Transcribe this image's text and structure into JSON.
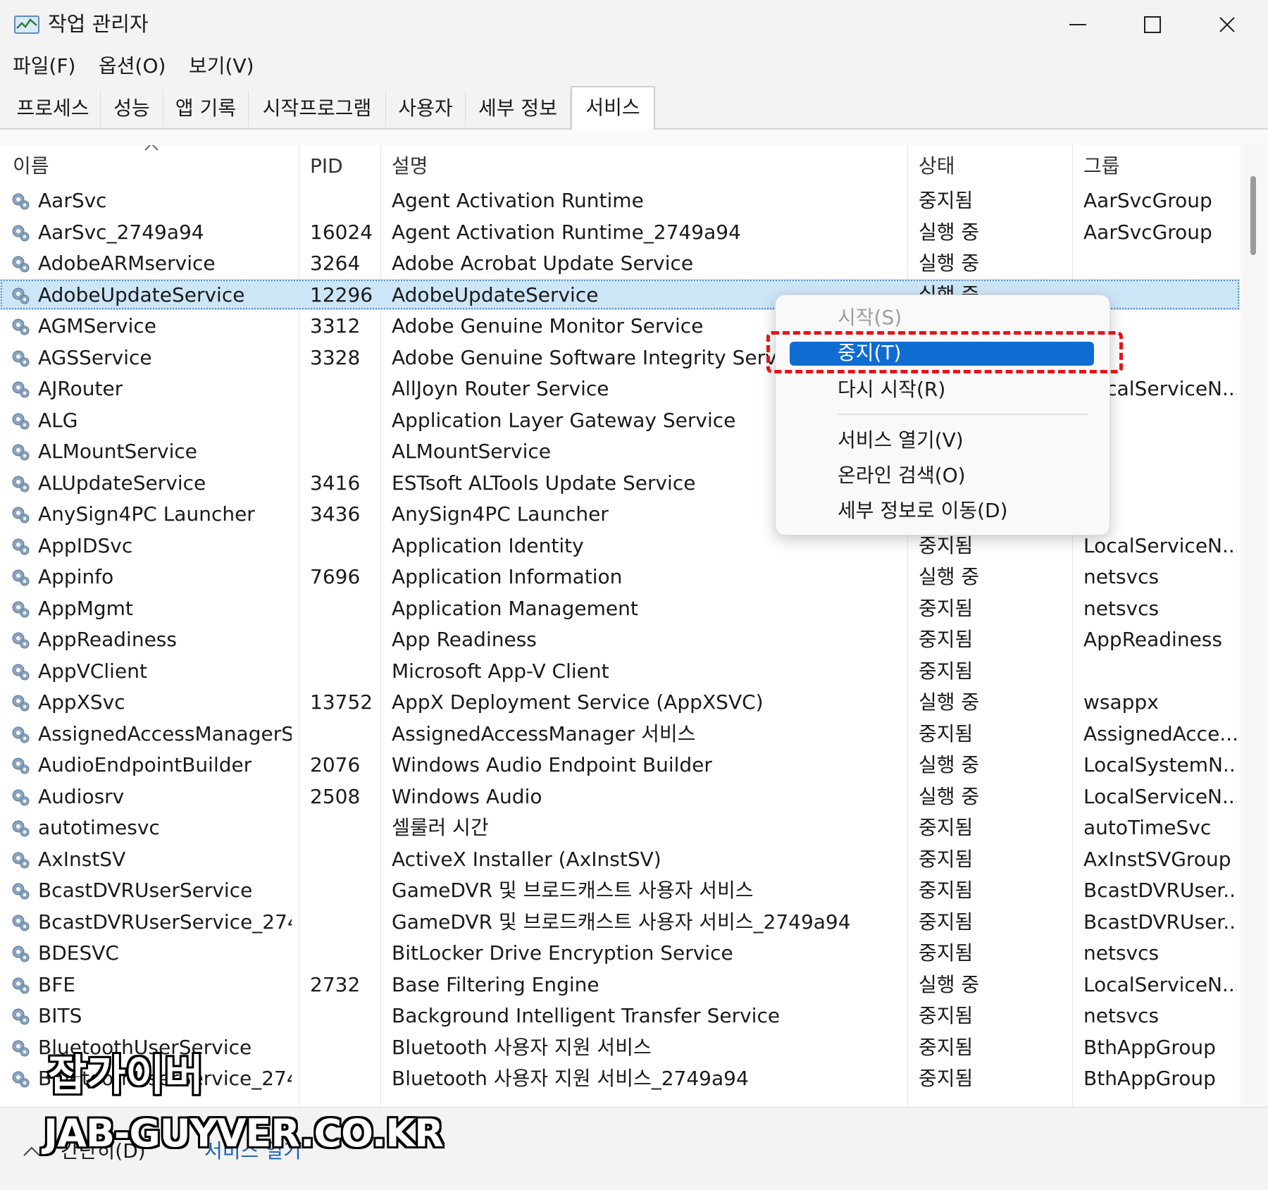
{
  "window": {
    "title": "작업 관리자"
  },
  "menu": {
    "file": "파일(F)",
    "options": "옵션(O)",
    "view": "보기(V)"
  },
  "tabs": [
    "프로세스",
    "성능",
    "앱 기록",
    "시작프로그램",
    "사용자",
    "세부 정보",
    "서비스"
  ],
  "active_tab": "서비스",
  "columns": {
    "name": "이름",
    "pid": "PID",
    "desc": "설명",
    "status": "상태",
    "group": "그룹"
  },
  "rows": [
    {
      "name": "AarSvc",
      "pid": "",
      "desc": "Agent Activation Runtime",
      "status": "중지됨",
      "group": "AarSvcGroup"
    },
    {
      "name": "AarSvc_2749a94",
      "pid": "16024",
      "desc": "Agent Activation Runtime_2749a94",
      "status": "실행 중",
      "group": "AarSvcGroup"
    },
    {
      "name": "AdobeARMservice",
      "pid": "3264",
      "desc": "Adobe Acrobat Update Service",
      "status": "실행 중",
      "group": ""
    },
    {
      "name": "AdobeUpdateService",
      "pid": "12296",
      "desc": "AdobeUpdateService",
      "status": "실행 중",
      "group": ""
    },
    {
      "name": "AGMService",
      "pid": "3312",
      "desc": "Adobe Genuine Monitor Service",
      "status": "",
      "group": ""
    },
    {
      "name": "AGSService",
      "pid": "3328",
      "desc": "Adobe Genuine Software Integrity Service",
      "status": "",
      "group": ""
    },
    {
      "name": "AJRouter",
      "pid": "",
      "desc": "AllJoyn Router Service",
      "status": "",
      "group": "LocalServiceN..."
    },
    {
      "name": "ALG",
      "pid": "",
      "desc": "Application Layer Gateway Service",
      "status": "",
      "group": ""
    },
    {
      "name": "ALMountService",
      "pid": "",
      "desc": "ALMountService",
      "status": "",
      "group": ""
    },
    {
      "name": "ALUpdateService",
      "pid": "3416",
      "desc": "ESTsoft ALTools Update Service",
      "status": "",
      "group": ""
    },
    {
      "name": "AnySign4PC Launcher",
      "pid": "3436",
      "desc": "AnySign4PC Launcher",
      "status": "",
      "group": ""
    },
    {
      "name": "AppIDSvc",
      "pid": "",
      "desc": "Application Identity",
      "status": "중지됨",
      "group": "LocalServiceN..."
    },
    {
      "name": "Appinfo",
      "pid": "7696",
      "desc": "Application Information",
      "status": "실행 중",
      "group": "netsvcs"
    },
    {
      "name": "AppMgmt",
      "pid": "",
      "desc": "Application Management",
      "status": "중지됨",
      "group": "netsvcs"
    },
    {
      "name": "AppReadiness",
      "pid": "",
      "desc": "App Readiness",
      "status": "중지됨",
      "group": "AppReadiness"
    },
    {
      "name": "AppVClient",
      "pid": "",
      "desc": "Microsoft App-V Client",
      "status": "중지됨",
      "group": ""
    },
    {
      "name": "AppXSvc",
      "pid": "13752",
      "desc": "AppX Deployment Service (AppXSVC)",
      "status": "실행 중",
      "group": "wsappx"
    },
    {
      "name": "AssignedAccessManagerSvc",
      "pid": "",
      "desc": "AssignedAccessManager 서비스",
      "status": "중지됨",
      "group": "AssignedAcce..."
    },
    {
      "name": "AudioEndpointBuilder",
      "pid": "2076",
      "desc": "Windows Audio Endpoint Builder",
      "status": "실행 중",
      "group": "LocalSystemN..."
    },
    {
      "name": "Audiosrv",
      "pid": "2508",
      "desc": "Windows Audio",
      "status": "실행 중",
      "group": "LocalServiceN..."
    },
    {
      "name": "autotimesvc",
      "pid": "",
      "desc": "셀룰러 시간",
      "status": "중지됨",
      "group": "autoTimeSvc"
    },
    {
      "name": "AxInstSV",
      "pid": "",
      "desc": "ActiveX Installer (AxInstSV)",
      "status": "중지됨",
      "group": "AxInstSVGroup"
    },
    {
      "name": "BcastDVRUserService",
      "pid": "",
      "desc": "GameDVR 및 브로드캐스트 사용자 서비스",
      "status": "중지됨",
      "group": "BcastDVRUser..."
    },
    {
      "name": "BcastDVRUserService_274...",
      "pid": "",
      "desc": "GameDVR 및 브로드캐스트 사용자 서비스_2749a94",
      "status": "중지됨",
      "group": "BcastDVRUser..."
    },
    {
      "name": "BDESVC",
      "pid": "",
      "desc": "BitLocker Drive Encryption Service",
      "status": "중지됨",
      "group": "netsvcs"
    },
    {
      "name": "BFE",
      "pid": "2732",
      "desc": "Base Filtering Engine",
      "status": "실행 중",
      "group": "LocalServiceN..."
    },
    {
      "name": "BITS",
      "pid": "",
      "desc": "Background Intelligent Transfer Service",
      "status": "중지됨",
      "group": "netsvcs"
    },
    {
      "name": "BluetoothUserService",
      "pid": "",
      "desc": "Bluetooth 사용자 지원 서비스",
      "status": "중지됨",
      "group": "BthAppGroup"
    },
    {
      "name": "BluetoothUserService_274...",
      "pid": "",
      "desc": "Bluetooth 사용자 지원 서비스_2749a94",
      "status": "중지됨",
      "group": "BthAppGroup"
    }
  ],
  "selected_row": "AdobeUpdateService",
  "context_menu": {
    "start": "시작(S)",
    "stop": "중지(T)",
    "restart": "다시 시작(R)",
    "open_services": "서비스 열기(V)",
    "search_online": "온라인 검색(O)",
    "go_to_details": "세부 정보로 이동(D)"
  },
  "status_bar": {
    "less_details": "간단히(D)",
    "open_services": "서비스 열기"
  },
  "watermark": {
    "line1": "잡가이버",
    "line2": "JAB-GUYVER.CO.KR"
  },
  "colors": {
    "selection": "#cde6f7",
    "menu_highlight": "#0f6cd1",
    "annotation": "#e3141b"
  }
}
